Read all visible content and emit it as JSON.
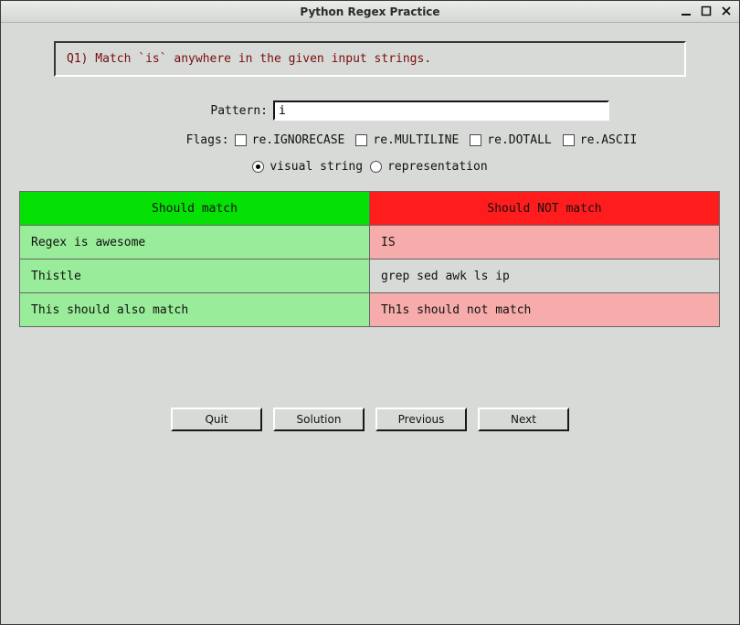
{
  "window": {
    "title": "Python Regex Practice"
  },
  "question": {
    "text": "Q1) Match `is` anywhere in the given input strings."
  },
  "pattern": {
    "label": "Pattern:",
    "value": "i"
  },
  "flags": {
    "label": "Flags:",
    "items": [
      {
        "label": "re.IGNORECASE",
        "checked": false
      },
      {
        "label": "re.MULTILINE",
        "checked": false
      },
      {
        "label": "re.DOTALL",
        "checked": false
      },
      {
        "label": "re.ASCII",
        "checked": false
      }
    ]
  },
  "mode": {
    "options": [
      {
        "label": "visual string",
        "selected": true
      },
      {
        "label": "representation",
        "selected": false
      }
    ]
  },
  "table": {
    "headers": {
      "match": "Should match",
      "nomatch": "Should NOT match"
    },
    "rows": [
      {
        "match": {
          "text": "Regex is awesome",
          "state": "pass-green"
        },
        "nomatch": {
          "text": "IS",
          "state": "pass-pink"
        }
      },
      {
        "match": {
          "text": "Thistle",
          "state": "pass-green"
        },
        "nomatch": {
          "text": "grep sed awk ls ip",
          "state": "neutral"
        }
      },
      {
        "match": {
          "text": "This should also match",
          "state": "pass-green"
        },
        "nomatch": {
          "text": "Th1s should not match",
          "state": "pass-pink"
        }
      }
    ]
  },
  "buttons": {
    "quit": "Quit",
    "solution": "Solution",
    "previous": "Previous",
    "next": "Next"
  }
}
